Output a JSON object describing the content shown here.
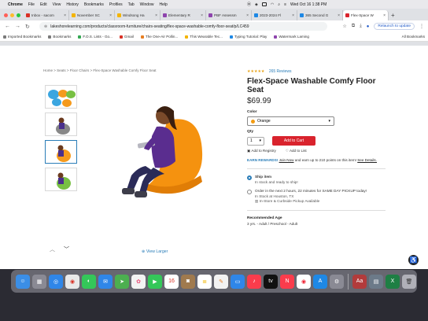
{
  "menubar": {
    "items": [
      "Chrome",
      "File",
      "Edit",
      "View",
      "History",
      "Bookmarks",
      "Profiles",
      "Tab",
      "Window",
      "Help"
    ],
    "clock": "Wed Oct 16 1:38 PM"
  },
  "tabs": [
    {
      "label": "Inbox - sacom",
      "color": "#d93025"
    },
    {
      "label": "November SC",
      "color": "#f4b400"
    },
    {
      "label": "Windsong Ha",
      "color": "#f4b400"
    },
    {
      "label": "Elementary R",
      "color": "#8e44ad"
    },
    {
      "label": "PBF Assessm",
      "color": "#8e44ad"
    },
    {
      "label": "2023-2024 Fl",
      "color": "#1e88e5"
    },
    {
      "label": "365 Second G",
      "color": "#1e88e5"
    },
    {
      "label": "Flex-Space W",
      "color": "#d9232d",
      "active": true
    }
  ],
  "toolbar": {
    "url": "lakeshorelearning.com/products/classroom-furniture/chairs-seating/flex-space-washable-comfy-floor-seat/p/LC459",
    "relaunch": "Relaunch to update"
  },
  "bookmarks": [
    {
      "label": "Imported Bookmarks",
      "color": "#7a7a7a"
    },
    {
      "label": "Bookmarks",
      "color": "#7a7a7a"
    },
    {
      "label": "F.O.S. Lists - Go...",
      "color": "#34a853"
    },
    {
      "label": "Gmail",
      "color": "#d93025"
    },
    {
      "label": "The One-Air Pollin...",
      "color": "#e67e22"
    },
    {
      "label": "This Wearable Tec...",
      "color": "#f4b400"
    },
    {
      "label": "Typing Tutorial: Play",
      "color": "#1e88e5"
    },
    {
      "label": "Watermark Laming",
      "color": "#8e44ad"
    }
  ],
  "all_bookmarks": "All Bookmarks",
  "breadcrumb": "Home > Seats > Floor Chairs > Flex-Space Washable Comfy Floor Seat",
  "product": {
    "stars": "★★★★★",
    "reviews": "265 Reviews",
    "title": "Flex-Space Washable Comfy Floor Seat",
    "price": "$69.99",
    "color_label": "Color",
    "color_value": "Orange",
    "qty_label": "Qty",
    "qty_value": "1",
    "add_to_cart": "Add to Cart",
    "add_registry": "Add to Registry",
    "add_list": "Add to List",
    "rewards_prefix": "EARN REWARDS!",
    "rewards_join": "Join Now",
    "rewards_text": "and earn up to 210 points on this item!",
    "rewards_details": "See Details.",
    "ship_title": "Ship item",
    "ship_sub": "In stock and ready to ship!",
    "pickup_text": "Order in the next 2 hours, 22 minutes for SAME DAY PICKUP today!",
    "pickup_store": "In Stock at Houston, TX",
    "pickup_methods": "In-Store & Curbside Pickup Available",
    "age_label": "Recommended Age",
    "age_value": "3 yrs. - Adult / Preschool - Adult",
    "view_larger": "View Larger"
  }
}
